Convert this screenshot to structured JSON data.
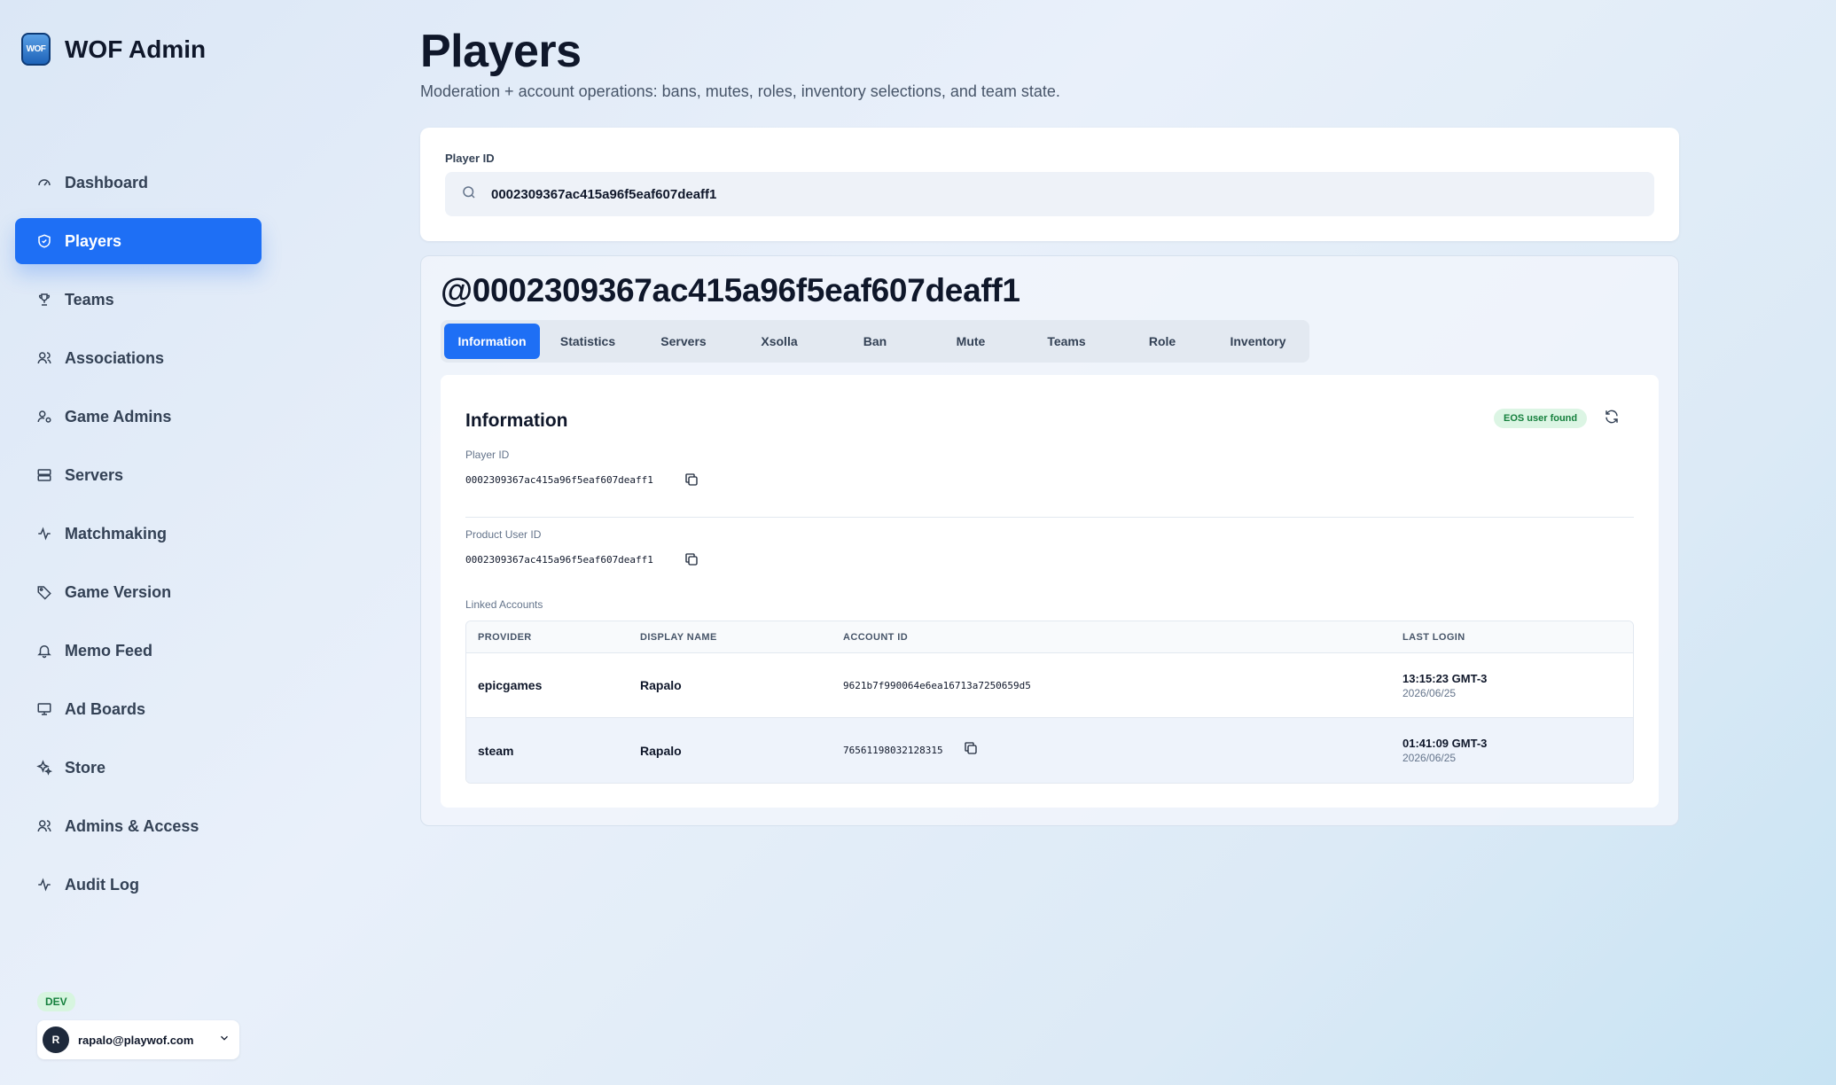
{
  "app": {
    "title": "WOF Admin",
    "logo_text": "WOF"
  },
  "sidebar": {
    "items": [
      {
        "label": "Dashboard",
        "icon": "gauge-icon",
        "active": false
      },
      {
        "label": "Players",
        "icon": "shield-icon",
        "active": true
      },
      {
        "label": "Teams",
        "icon": "trophy-icon",
        "active": false
      },
      {
        "label": "Associations",
        "icon": "users-icon",
        "active": false
      },
      {
        "label": "Game Admins",
        "icon": "user-cog-icon",
        "active": false
      },
      {
        "label": "Servers",
        "icon": "server-icon",
        "active": false
      },
      {
        "label": "Matchmaking",
        "icon": "activity-icon",
        "active": false
      },
      {
        "label": "Game Version",
        "icon": "tag-icon",
        "active": false
      },
      {
        "label": "Memo Feed",
        "icon": "bell-icon",
        "active": false
      },
      {
        "label": "Ad Boards",
        "icon": "monitor-icon",
        "active": false
      },
      {
        "label": "Store",
        "icon": "sparkles-icon",
        "active": false
      },
      {
        "label": "Admins & Access",
        "icon": "users-icon",
        "active": false
      },
      {
        "label": "Audit Log",
        "icon": "activity-icon",
        "active": false
      }
    ],
    "env_badge": "DEV",
    "user": {
      "initial": "R",
      "email": "rapalo@playwof.com"
    }
  },
  "page": {
    "title": "Players",
    "subtitle": "Moderation + account operations: bans, mutes, roles, inventory selections, and team state."
  },
  "search": {
    "label": "Player ID",
    "value": "0002309367ac415a96f5eaf607deaff1"
  },
  "player": {
    "handle": "@0002309367ac415a96f5eaf607deaff1",
    "tabs": [
      "Information",
      "Statistics",
      "Servers",
      "Xsolla",
      "Ban",
      "Mute",
      "Teams",
      "Role",
      "Inventory"
    ],
    "active_tab": "Information"
  },
  "info": {
    "title": "Information",
    "status_badge": "EOS user found",
    "player_id_label": "Player ID",
    "player_id": "0002309367ac415a96f5eaf607deaff1",
    "product_user_id_label": "Product User ID",
    "product_user_id": "0002309367ac415a96f5eaf607deaff1",
    "linked_accounts_label": "Linked Accounts",
    "table": {
      "headers": [
        "PROVIDER",
        "DISPLAY NAME",
        "ACCOUNT ID",
        "LAST LOGIN"
      ],
      "rows": [
        {
          "provider": "epicgames",
          "display_name": "Rapalo",
          "account_id": "9621b7f990064e6ea16713a7250659d5",
          "login_time": "13:15:23 GMT-3",
          "login_date": "2026/06/25",
          "copy": false
        },
        {
          "provider": "steam",
          "display_name": "Rapalo",
          "account_id": "76561198032128315",
          "login_time": "01:41:09 GMT-3",
          "login_date": "2026/06/25",
          "copy": true
        }
      ]
    }
  },
  "colors": {
    "accent": "#1e6ff5",
    "success_bg": "#dcf5e4",
    "success_text": "#15803d"
  }
}
